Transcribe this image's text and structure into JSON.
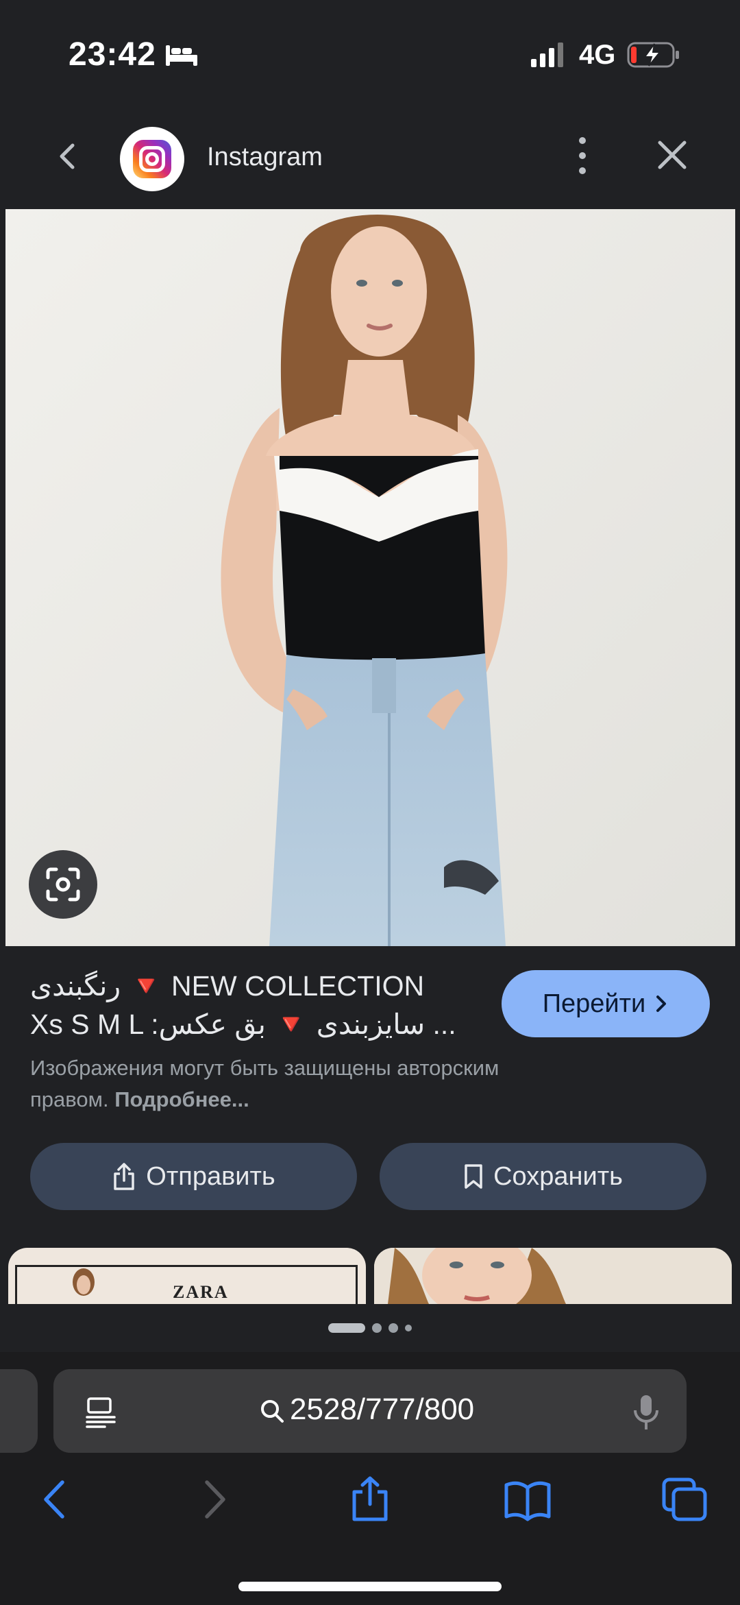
{
  "status_bar": {
    "time": "23:42",
    "network": "4G",
    "icons": [
      "bed-icon",
      "signal-icon",
      "battery-charging-icon"
    ]
  },
  "header": {
    "source_title": "Instagram",
    "icons": [
      "back-icon",
      "instagram-logo",
      "more-vert-icon",
      "close-icon"
    ]
  },
  "caption": {
    "line1": "رنگبندی 🔻 NEW COLLECTION",
    "line2": "Xs S M L  :سایزبندی 🔻 بق عکس   ...",
    "copyright_text": "Изображения могут быть защищены авторским правом.",
    "more_link": "Подробнее..."
  },
  "visit_button": {
    "label": "Перейти"
  },
  "actions": {
    "share_label": "Отправить",
    "save_label": "Сохранить"
  },
  "thumbnails": [
    {
      "brand_text": "ZARA"
    },
    {
      "brand_text": ""
    }
  ],
  "browser": {
    "url": "2528/777/800",
    "accent_color": "#3a84f6",
    "icons": [
      "reader-icon",
      "search-icon",
      "mic-icon",
      "back-arrow-icon",
      "forward-arrow-icon",
      "share-icon",
      "bookmarks-icon",
      "tabs-icon"
    ]
  },
  "colors": {
    "background": "#202124",
    "visit_button": "#8ab4f8",
    "action_button": "#394457"
  }
}
